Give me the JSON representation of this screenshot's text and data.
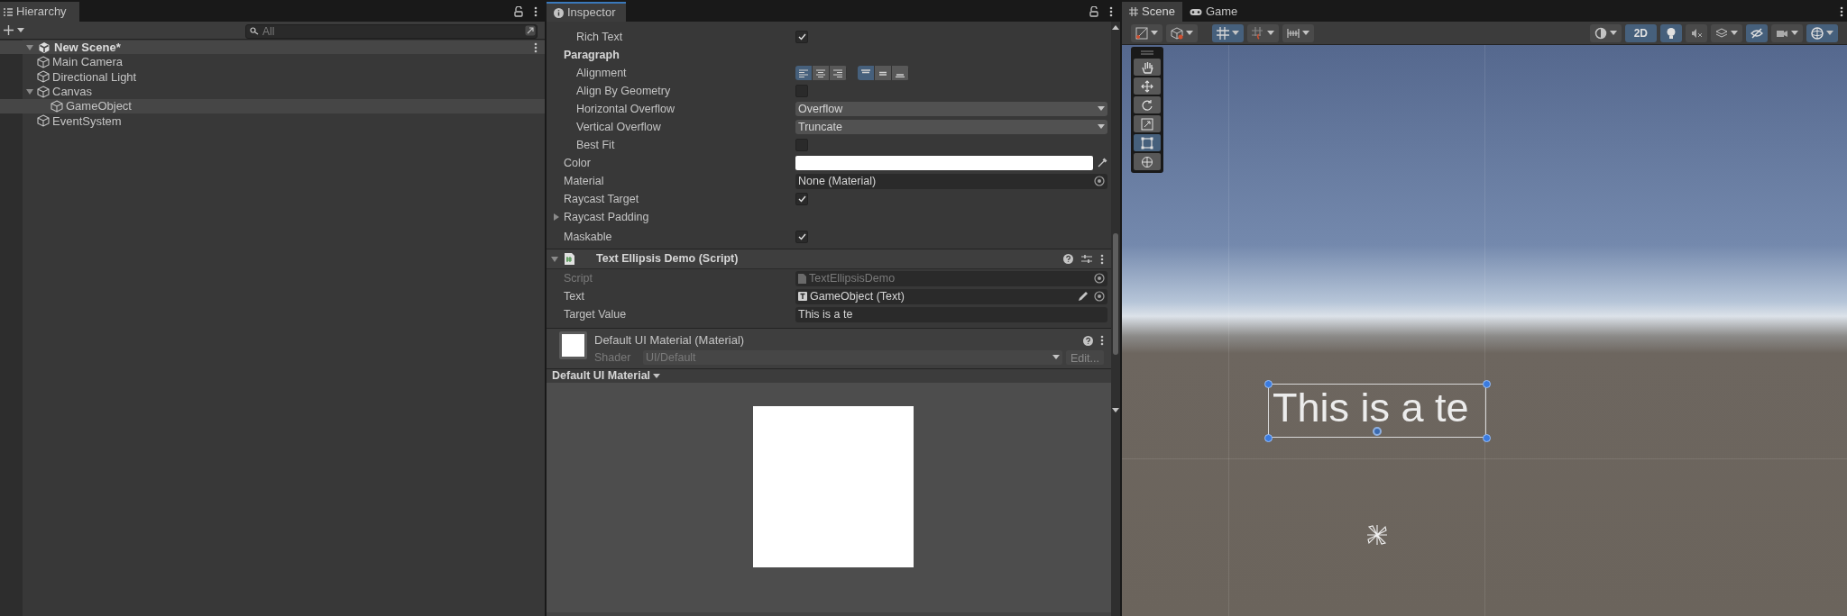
{
  "hierarchy": {
    "title": "Hierarchy",
    "search": {
      "placeholder": "All"
    },
    "scene": {
      "name": "New Scene*",
      "expanded": true,
      "children": [
        {
          "name": "Main Camera",
          "selected": false
        },
        {
          "name": "Directional Light",
          "selected": false
        },
        {
          "name": "Canvas",
          "selected": false,
          "expanded": true,
          "children": [
            {
              "name": "GameObject",
              "selected": true
            }
          ]
        },
        {
          "name": "EventSystem",
          "selected": false
        }
      ]
    }
  },
  "inspector": {
    "title": "Inspector",
    "fields": [
      {
        "kind": "group",
        "children": [
          {
            "kind": "checkbox",
            "label": "Rich Text",
            "checked": true
          }
        ]
      },
      {
        "kind": "group",
        "label": "Paragraph",
        "children": [
          {
            "kind": "alignment",
            "label": "Alignment",
            "horizontal": [
              {
                "selected": true
              },
              {
                "selected": false
              },
              {
                "selected": false
              }
            ],
            "vertical": [
              {
                "selected": true
              },
              {
                "selected": false
              },
              {
                "selected": false
              }
            ]
          },
          {
            "kind": "checkbox",
            "label": "Align By Geometry",
            "checked": false
          },
          {
            "kind": "dropdown",
            "label": "Horizontal Overflow",
            "value": "Overflow"
          },
          {
            "kind": "dropdown",
            "label": "Vertical Overflow",
            "value": "Truncate"
          },
          {
            "kind": "checkbox",
            "label": "Best Fit",
            "checked": false
          }
        ]
      },
      {
        "kind": "color",
        "label": "Color",
        "color": "#ffffff"
      },
      {
        "kind": "object",
        "label": "Material",
        "value": "None (Material)"
      },
      {
        "kind": "checkbox",
        "label": "Raycast Target",
        "checked": true
      },
      {
        "kind": "foldout",
        "label": "Raycast Padding",
        "expanded": false
      },
      {
        "kind": "checkbox",
        "label": "Maskable",
        "checked": true
      }
    ],
    "script_component": {
      "title": "Text Ellipsis Demo (Script)",
      "expanded": true,
      "fields": [
        {
          "kind": "object",
          "label": "Script",
          "value": "TextEllipsisDemo",
          "disabled": true
        },
        {
          "kind": "object",
          "label": "Text",
          "value": "GameObject (Text)",
          "disabled": false
        },
        {
          "kind": "text",
          "label": "Target Value",
          "value": "This is a te"
        }
      ]
    },
    "material": {
      "title": "Default UI Material (Material)",
      "shader_label": "Shader",
      "shader": "UI/Default",
      "edit_button": "Edit..."
    },
    "preview": {
      "title": "Default UI Material"
    }
  },
  "scene_view": {
    "tabs": [
      {
        "label": "Scene",
        "selected": true
      },
      {
        "label": "Game",
        "selected": false
      }
    ],
    "mode_2d": {
      "label": "2D",
      "on": true
    },
    "tools": [
      {
        "kind": "hand",
        "selected": false
      },
      {
        "kind": "move",
        "selected": false
      },
      {
        "kind": "rotate",
        "selected": false
      },
      {
        "kind": "scale",
        "selected": false
      },
      {
        "kind": "rect",
        "selected": true
      },
      {
        "kind": "transform",
        "selected": false
      }
    ],
    "text_object": {
      "text": "This is a te"
    }
  }
}
